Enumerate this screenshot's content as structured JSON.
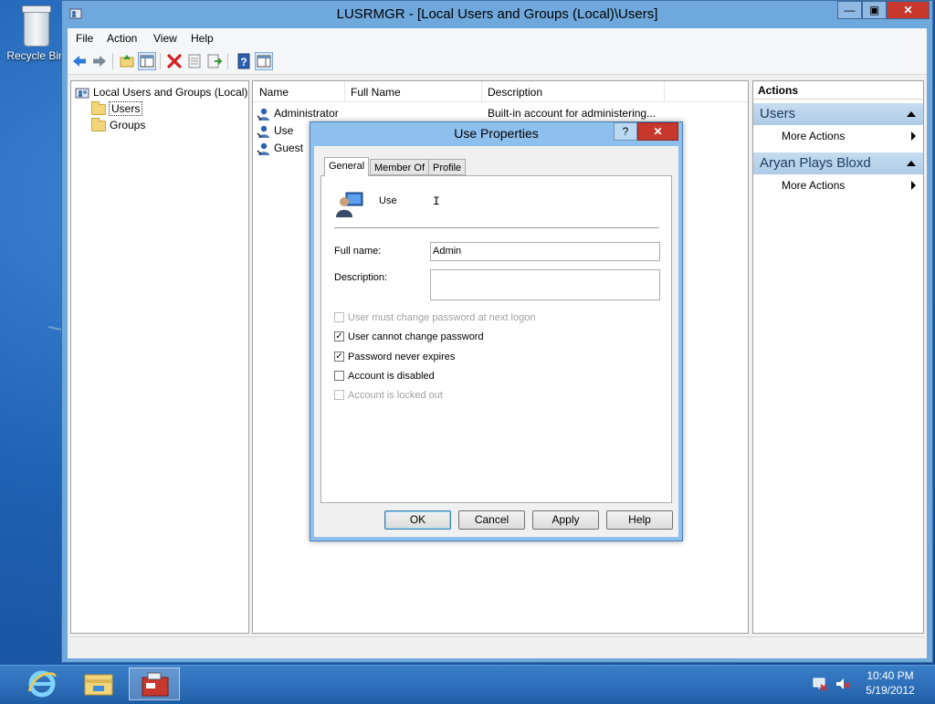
{
  "desktop": {
    "recycle_label": "Recycle Bin"
  },
  "window": {
    "title": "LUSRMGR - [Local Users and Groups (Local)\\Users]",
    "min_icon": "minimize-icon",
    "max_icon": "maximize-icon",
    "close_icon": "close-icon"
  },
  "menu": [
    "File",
    "Action",
    "View",
    "Help"
  ],
  "tree": {
    "root": "Local Users and Groups (Local)",
    "items": [
      "Users",
      "Groups"
    ]
  },
  "list": {
    "columns": [
      "Name",
      "Full Name",
      "Description"
    ],
    "rows": [
      {
        "name": "Administrator",
        "full_name": "",
        "description": "Built-in account for administering..."
      },
      {
        "name": "Use",
        "full_name": "",
        "description": ""
      },
      {
        "name": "Guest",
        "full_name": "",
        "description": ""
      }
    ]
  },
  "actions": {
    "header": "Actions",
    "groups": [
      {
        "title": "Users",
        "item": "More Actions"
      },
      {
        "title": "Aryan Plays Bloxd",
        "item": "More Actions"
      }
    ]
  },
  "dialog": {
    "title": "Use Properties",
    "help_glyph": "?",
    "tabs": [
      "General",
      "Member Of",
      "Profile"
    ],
    "username": "Use",
    "full_name_label": "Full name:",
    "full_name_value": "Admin",
    "description_label": "Description:",
    "description_value": "",
    "checkboxes": [
      {
        "label": "User must change password at next logon",
        "checked": false,
        "enabled": false
      },
      {
        "label": "User cannot change password",
        "checked": true,
        "enabled": true
      },
      {
        "label": "Password never expires",
        "checked": true,
        "enabled": true
      },
      {
        "label": "Account is disabled",
        "checked": false,
        "enabled": true
      },
      {
        "label": "Account is locked out",
        "checked": false,
        "enabled": false
      }
    ],
    "buttons": [
      "OK",
      "Cancel",
      "Apply",
      "Help"
    ]
  },
  "taskbar": {
    "time": "10:40 PM",
    "date": "5/19/2012",
    "pinned": [
      "internet-explorer-icon",
      "file-explorer-icon",
      "computer-management-icon"
    ]
  },
  "colors": {
    "accent": "#2362ab",
    "close_red": "#c7372c",
    "group_header": "#c6dcf0"
  }
}
